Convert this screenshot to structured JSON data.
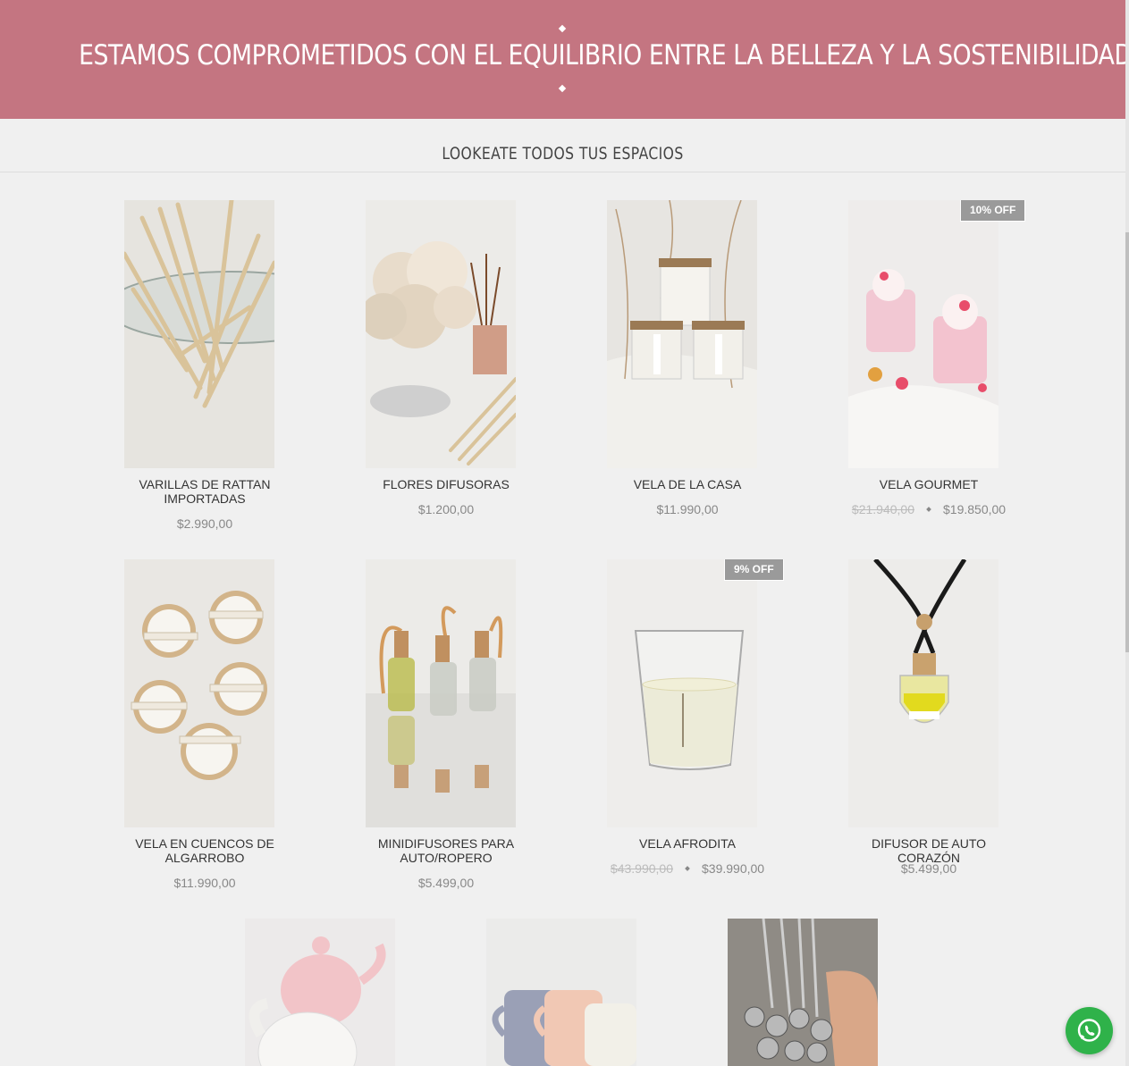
{
  "banner": {
    "title": "ESTAMOS COMPROMETIDOS CON EL EQUILIBRIO ENTRE LA BELLEZA Y LA SOSTENIBILIDAD."
  },
  "section": {
    "title": "LOOKEATE TODOS TUS ESPACIOS"
  },
  "products": [
    {
      "name": "VARILLAS DE RATTAN IMPORTADAS",
      "price": "$2.990,00"
    },
    {
      "name": "FLORES DIFUSORAS",
      "price": "$1.200,00"
    },
    {
      "name": "VELA DE LA CASA",
      "price": "$11.990,00"
    },
    {
      "name": "VELA GOURMET",
      "old_price": "$21.940,00",
      "price": "$19.850,00",
      "badge": "10% OFF"
    },
    {
      "name": "VELA EN CUENCOS DE ALGARROBO",
      "price": "$11.990,00"
    },
    {
      "name": "MINIDIFUSORES PARA AUTO/ROPERO",
      "price": "$5.499,00"
    },
    {
      "name": "VELA AFRODITA",
      "old_price": "$43.990,00",
      "price": "$39.990,00",
      "badge": "9% OFF"
    },
    {
      "name": "DIFUSOR DE AUTO CORAZÓN",
      "price": "$5.499,00"
    }
  ],
  "icons": {
    "whatsapp": "whatsapp-icon"
  },
  "colors": {
    "banner": "#c47581",
    "whatsapp": "#2fb24a",
    "badge": "#9a9a9a"
  }
}
